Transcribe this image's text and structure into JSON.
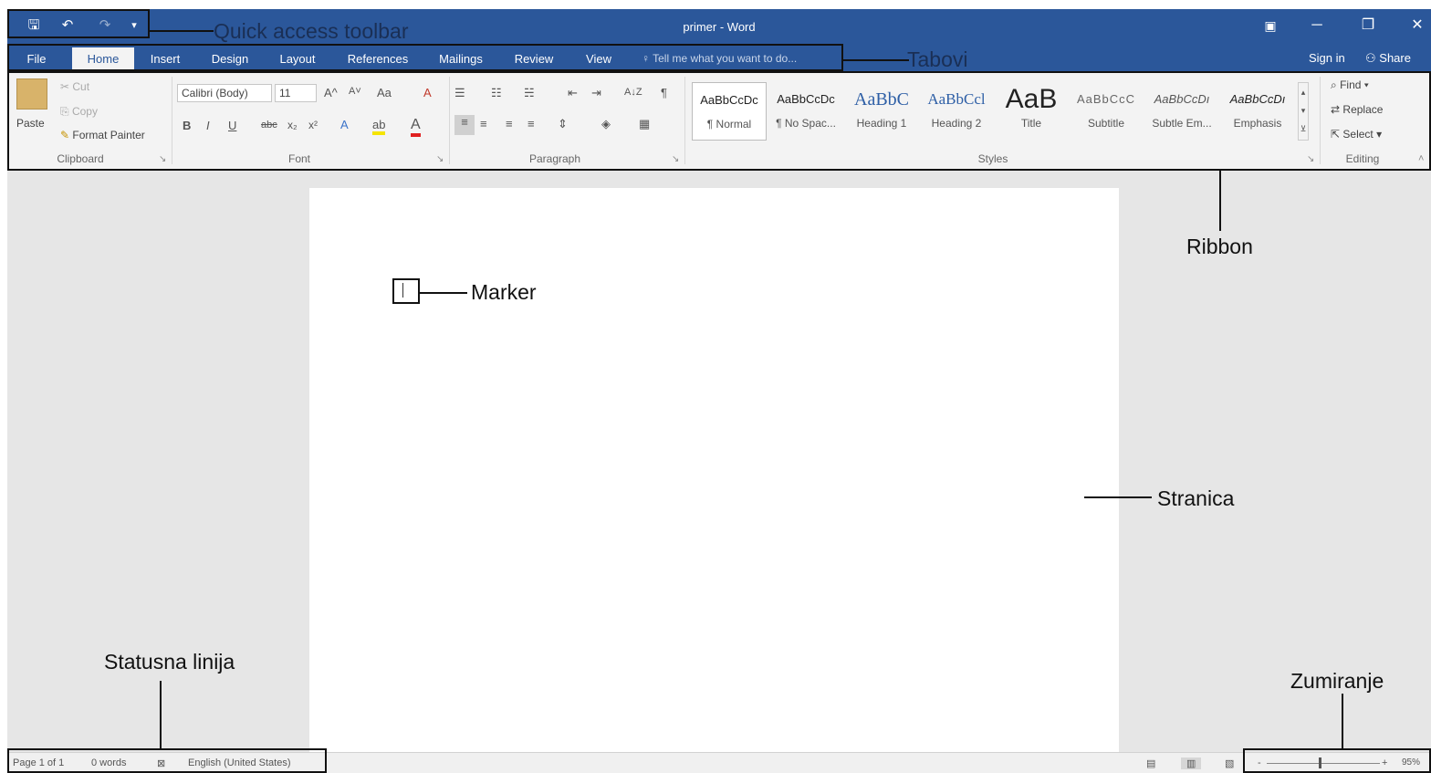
{
  "window": {
    "title": "primer - Word",
    "qat": {
      "save": "🖫",
      "undo": "↶",
      "redo": "↷",
      "customize": "▾"
    },
    "controls": {
      "ribbon_display": "▣",
      "minimize": "─",
      "restore": "❐",
      "close": "✕"
    }
  },
  "tabs": [
    {
      "label": "File"
    },
    {
      "label": "Home"
    },
    {
      "label": "Insert"
    },
    {
      "label": "Design"
    },
    {
      "label": "Layout"
    },
    {
      "label": "References"
    },
    {
      "label": "Mailings"
    },
    {
      "label": "Review"
    },
    {
      "label": "View"
    }
  ],
  "tell_me": "Tell me what you want to do...",
  "tell_me_icon": "♀",
  "account": {
    "sign_in": "Sign in",
    "share": "Share",
    "share_icon": "⚇"
  },
  "ribbon": {
    "clipboard": {
      "label": "Clipboard",
      "paste": "Paste",
      "cut": "Cut",
      "copy": "Copy",
      "format_painter": "Format Painter"
    },
    "font": {
      "label": "Font",
      "font_name": "Calibri (Body)",
      "font_size": "11",
      "bold": "B",
      "italic": "I",
      "underline": "U",
      "strike": "abc",
      "subscript": "x₂",
      "superscript": "x²",
      "grow": "A^",
      "shrink": "A˅",
      "change_case": "Aa",
      "clear": "A",
      "text_effects": "A",
      "highlight": "ab",
      "font_color": "A"
    },
    "paragraph": {
      "label": "Paragraph",
      "bullets": "☰",
      "numbering": "☷",
      "multilevel": "☵",
      "decrease_indent": "⇤",
      "increase_indent": "⇥",
      "sort": "A↓Z",
      "pilcrow": "¶"
    },
    "styles": {
      "label": "Styles",
      "items": [
        {
          "sample": "AaBbCcDc",
          "name": "¶ Normal"
        },
        {
          "sample": "AaBbCcDc",
          "name": "¶ No Spac..."
        },
        {
          "sample": "AaBbC",
          "name": "Heading 1"
        },
        {
          "sample": "AaBbCcl",
          "name": "Heading 2"
        },
        {
          "sample": "AaB",
          "name": "Title"
        },
        {
          "sample": "AaBbCcC",
          "name": "Subtitle"
        },
        {
          "sample": "AaBbCcDı",
          "name": "Subtle Em..."
        },
        {
          "sample": "AaBbCcDı",
          "name": "Emphasis"
        }
      ]
    },
    "editing": {
      "label": "Editing",
      "find": "Find",
      "replace": "Replace",
      "select": "Select"
    }
  },
  "status": {
    "page": "Page 1 of 1",
    "words": "0 words",
    "language": "English (United States)",
    "zoom": "95%"
  },
  "annotations": {
    "quick_access": "Quick access toolbar",
    "tabs": "Tabovi",
    "ribbon": "Ribbon",
    "marker": "Marker",
    "page": "Stranica",
    "statusbar": "Statusna linija",
    "zoom": "Zumiranje"
  },
  "colors": {
    "word_blue": "#2b579a",
    "ribbon_bg": "#f3f3f3",
    "workspace": "#e6e6e6"
  }
}
